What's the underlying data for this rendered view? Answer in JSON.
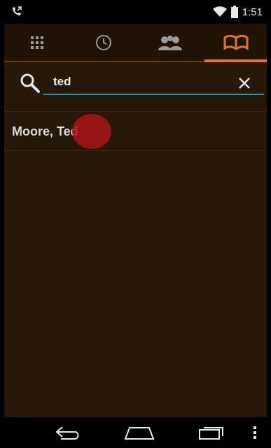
{
  "status": {
    "time": "1:51"
  },
  "tabs": [
    {
      "name": "dialpad",
      "icon": "dialpad-icon"
    },
    {
      "name": "recent",
      "icon": "clock-icon"
    },
    {
      "name": "groups",
      "icon": "groups-icon"
    },
    {
      "name": "contacts",
      "icon": "contacts-book-icon",
      "active": true
    }
  ],
  "search": {
    "value": "ted",
    "placeholder": ""
  },
  "results": [
    {
      "name": "Moore, Ted"
    }
  ],
  "nav": [
    "back-icon",
    "home-icon",
    "recents-icon",
    "menu-icon"
  ],
  "colors": {
    "accent": "#e0761d",
    "input_underline": "#2f8fb0",
    "background": "#261808"
  }
}
